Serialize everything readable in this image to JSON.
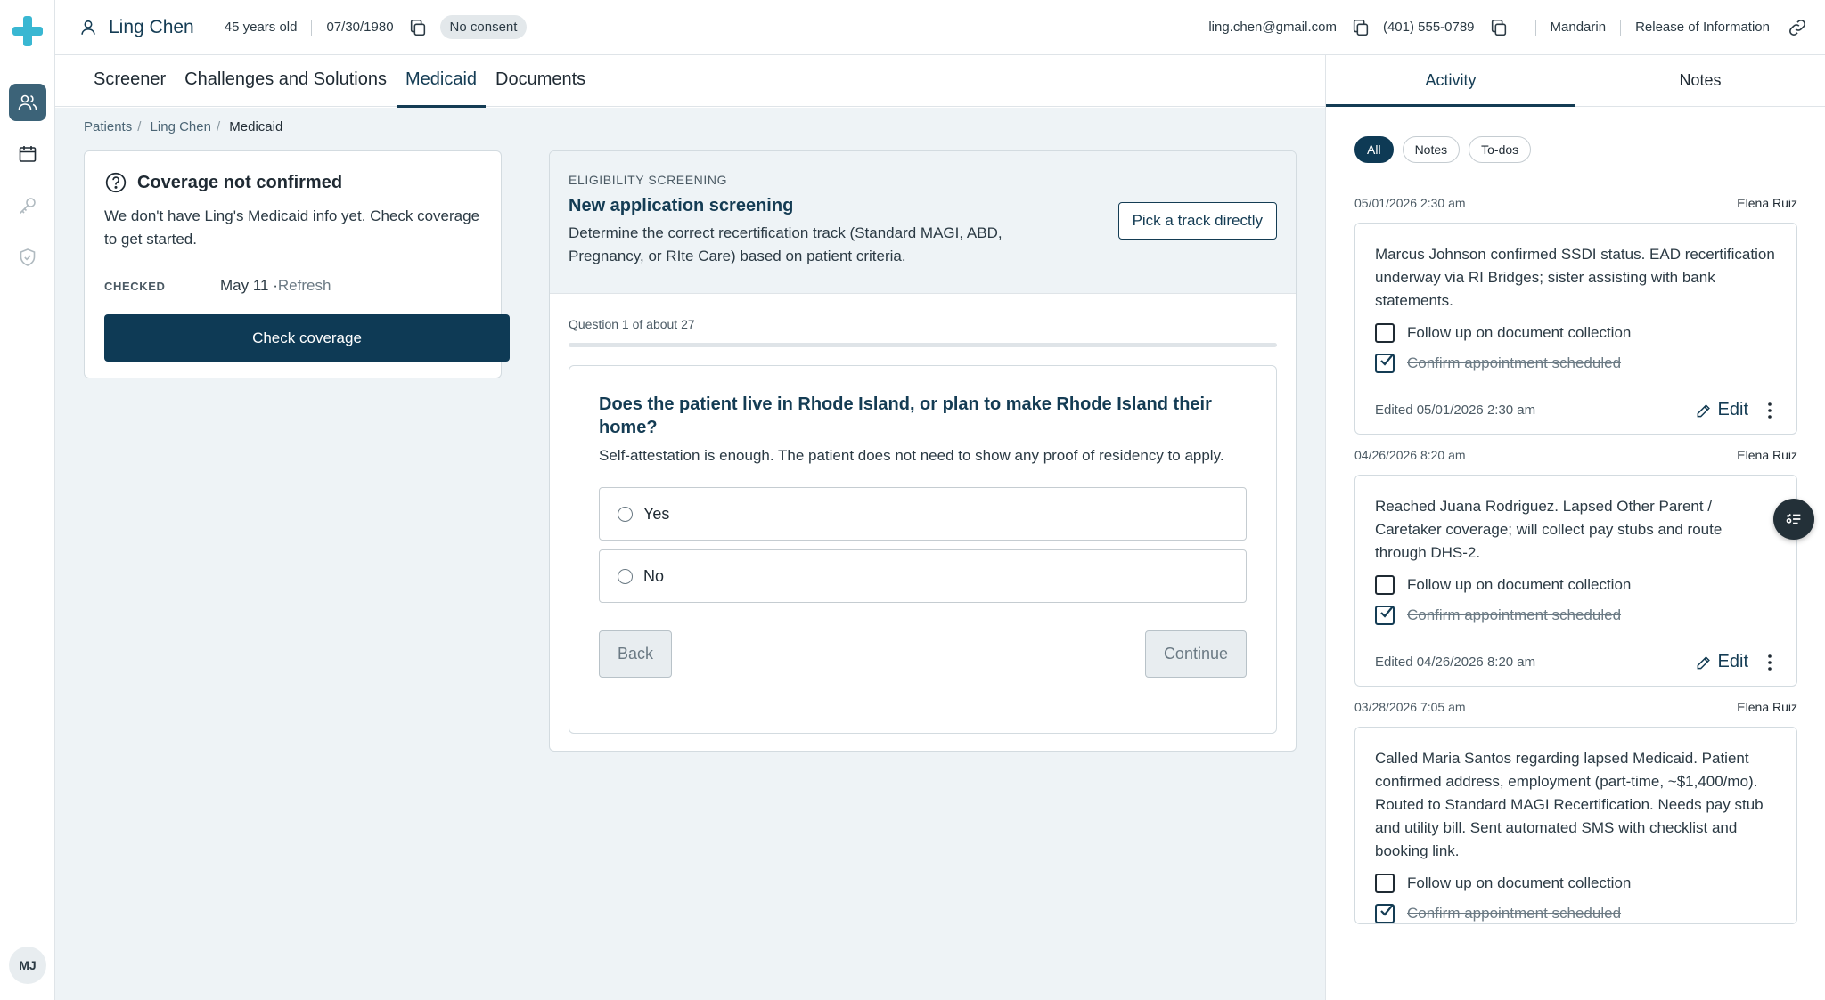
{
  "patient": {
    "name": "Ling Chen",
    "age": "45 years old",
    "dob": "07/30/1980",
    "consent_badge": "No consent",
    "email": "ling.chen@gmail.com",
    "phone": "(401) 555-0789",
    "language": "Mandarin",
    "release": "Release of Information"
  },
  "nav": {
    "user_initials": "MJ"
  },
  "tabs": [
    {
      "label": "Screener",
      "active": false
    },
    {
      "label": "Challenges and Solutions",
      "active": false
    },
    {
      "label": "Medicaid",
      "active": true
    },
    {
      "label": "Documents",
      "active": false
    }
  ],
  "breadcrumb": [
    "Patients",
    "Ling Chen",
    "Medicaid"
  ],
  "coverage": {
    "title": "Coverage not confirmed",
    "description": "We don't have Ling's Medicaid info yet. Check coverage to get started.",
    "checked_label": "CHECKED",
    "checked_value": "May 11 · ",
    "refresh_label": "Refresh",
    "button": "Check coverage"
  },
  "screening": {
    "eyebrow": "ELIGIBILITY SCREENING",
    "title": "New application screening",
    "subtitle": "Determine the correct recertification track (Standard MAGI, ABD, Pregnancy, or RIte Care) based on patient criteria.",
    "pick_button": "Pick a track directly",
    "progress_label": "Question 1 of about 27",
    "progress_fraction": 0.0,
    "question": "Does the patient live in Rhode Island, or plan to make Rhode Island their home?",
    "hint": "Self-attestation is enough. The patient does not need to show any proof of residency to apply.",
    "options": [
      "Yes",
      "No"
    ],
    "back": "Back",
    "continue": "Continue"
  },
  "panel": {
    "tabs": [
      {
        "label": "Activity",
        "active": true
      },
      {
        "label": "Notes",
        "active": false
      }
    ],
    "filters": [
      {
        "label": "All",
        "active": true
      },
      {
        "label": "Notes",
        "active": false
      },
      {
        "label": "To-dos",
        "active": false
      }
    ],
    "edit_label": "Edit",
    "entries": [
      {
        "date": "05/01/2026 2:30 am",
        "author": "Elena Ruiz",
        "body": "Marcus Johnson confirmed SSDI status. EAD recertification underway via RI Bridges; sister assisting with bank statements.",
        "todos": [
          {
            "text": "Follow up on document collection",
            "done": false
          },
          {
            "text": "Confirm appointment scheduled",
            "done": true
          }
        ],
        "edited": "Edited 05/01/2026 2:30 am"
      },
      {
        "date": "04/26/2026 8:20 am",
        "author": "Elena Ruiz",
        "body": "Reached Juana Rodriguez. Lapsed Other Parent / Caretaker coverage; will collect pay stubs and route through DHS-2.",
        "todos": [
          {
            "text": "Follow up on document collection",
            "done": false
          },
          {
            "text": "Confirm appointment scheduled",
            "done": true
          }
        ],
        "edited": "Edited 04/26/2026 8:20 am"
      },
      {
        "date": "03/28/2026 7:05 am",
        "author": "Elena Ruiz",
        "body": "Called Maria Santos regarding lapsed Medicaid. Patient confirmed address, employment (part-time, ~$1,400/mo). Routed to Standard MAGI Recertification. Needs pay stub and utility bill. Sent automated SMS with checklist and booking link.",
        "todos": [
          {
            "text": "Follow up on document collection",
            "done": false
          },
          {
            "text": "Confirm appointment scheduled",
            "done": true
          }
        ],
        "edited": ""
      }
    ]
  },
  "colors": {
    "brand": "#39b7d2",
    "primary": "#0e3a55",
    "accent_text": "#143c54",
    "main_bg": "#eef3f6"
  }
}
